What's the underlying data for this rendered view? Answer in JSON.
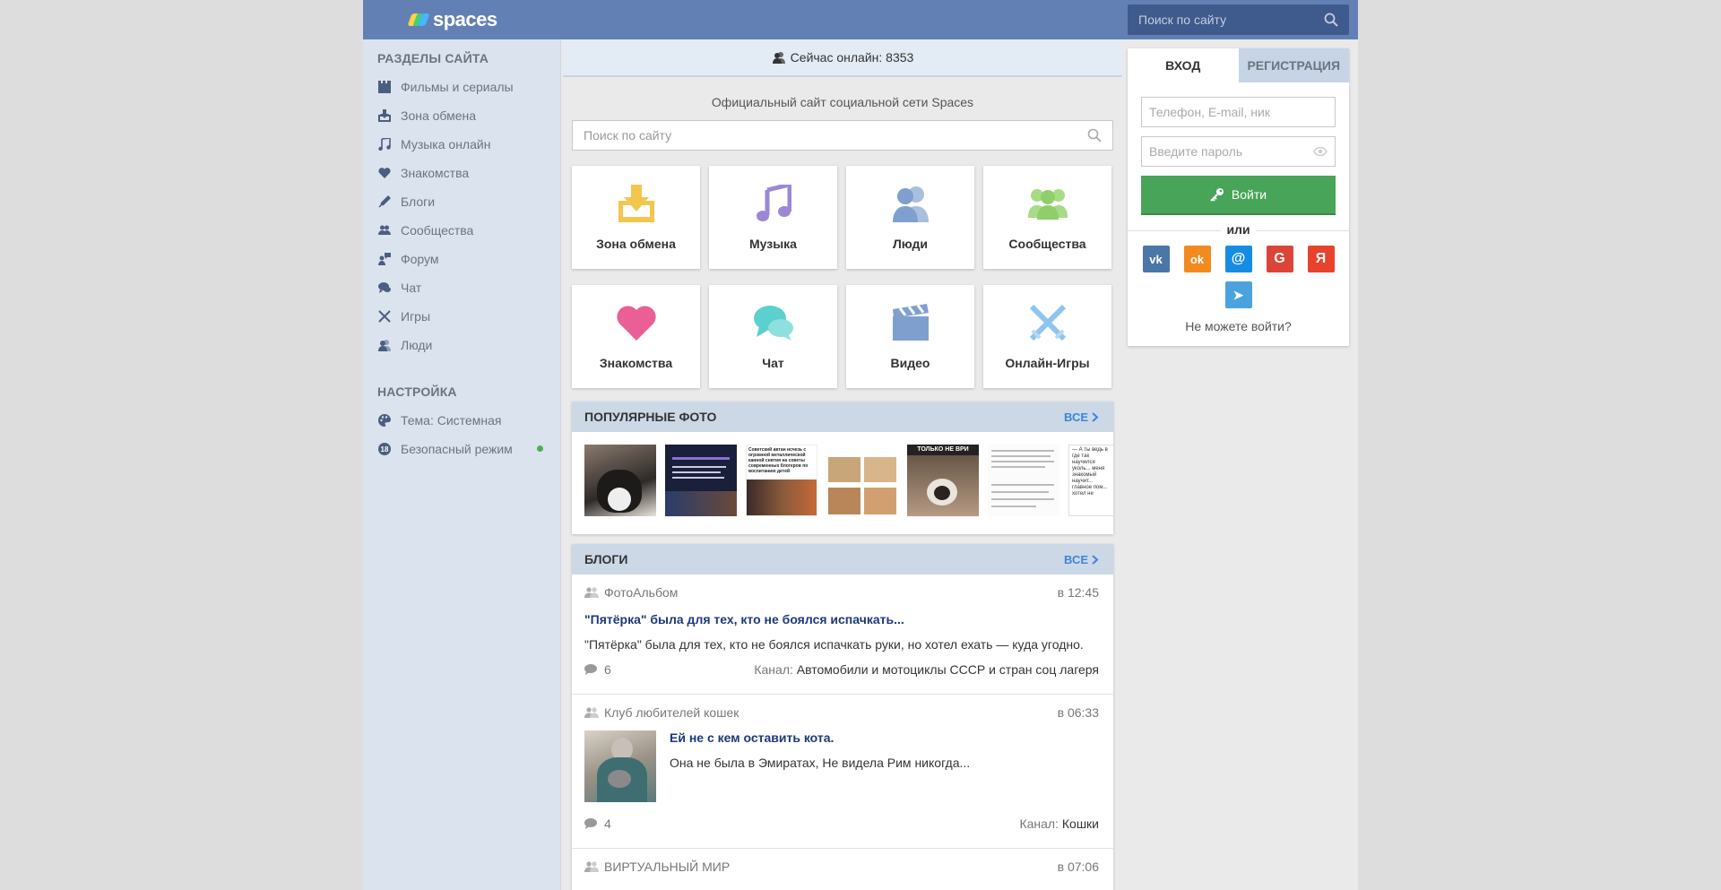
{
  "header": {
    "logo_text": "spaces",
    "search_placeholder": "Поиск по сайту"
  },
  "sidebar": {
    "sections_title": "РАЗДЕЛЫ САЙТА",
    "items": [
      {
        "label": "Фильмы и сериалы",
        "icon": "film-icon"
      },
      {
        "label": "Зона обмена",
        "icon": "download-icon"
      },
      {
        "label": "Музыка онлайн",
        "icon": "music-icon"
      },
      {
        "label": "Знакомства",
        "icon": "heart-icon"
      },
      {
        "label": "Блоги",
        "icon": "pen-icon"
      },
      {
        "label": "Сообщества",
        "icon": "group-icon"
      },
      {
        "label": "Форум",
        "icon": "forum-icon"
      },
      {
        "label": "Чат",
        "icon": "chat-icon"
      },
      {
        "label": "Игры",
        "icon": "swords-icon"
      },
      {
        "label": "Люди",
        "icon": "people-icon"
      }
    ],
    "settings_title": "НАСТРОЙКА",
    "settings": [
      {
        "label": "Тема: Системная",
        "icon": "palette-icon"
      },
      {
        "label": "Безопасный режим",
        "icon": "age-18-icon",
        "badge": "18",
        "status_color": "#4caf50"
      }
    ]
  },
  "main": {
    "online_label": "Сейчас онлайн: 8353",
    "official_text": "Официальный сайт социальной сети Spaces",
    "search_placeholder": "Поиск по сайту",
    "tiles_row1": [
      {
        "label": "Зона обмена",
        "icon": "download-icon",
        "color": "#f3c64e"
      },
      {
        "label": "Музыка",
        "icon": "music-icon",
        "color": "#9b87d6"
      },
      {
        "label": "Люди",
        "icon": "people-icon",
        "color": "#7f9fcf"
      },
      {
        "label": "Сообщества",
        "icon": "group-icon",
        "color": "#8fcf6a"
      }
    ],
    "tiles_row2": [
      {
        "label": "Знакомства",
        "icon": "heart-icon",
        "color": "#ea5f96"
      },
      {
        "label": "Чат",
        "icon": "chat-icon",
        "color": "#5ccfcf"
      },
      {
        "label": "Видео",
        "icon": "clapper-icon",
        "color": "#7f9fcf"
      },
      {
        "label": "Онлайн-Игры",
        "icon": "swords-icon",
        "color": "#8ec5ef"
      }
    ],
    "photos": {
      "title": "ПОПУЛЯРНЫЕ ФОТО",
      "all_label": "ВСЕ",
      "items": [
        {
          "caption": ""
        },
        {
          "caption": ""
        },
        {
          "caption": "Советский автан исчезь с огромной металлической канной снятия на советы современных блогеров по воспитанию детей"
        },
        {
          "caption": ""
        },
        {
          "caption": "ТОЛЬКО НЕ ВРИ"
        },
        {
          "caption": ""
        },
        {
          "caption": "— А ты ведь в где так научился уколь... меня знакомый научит... главное пом... хотел не"
        }
      ]
    },
    "blogs": {
      "title": "БЛОГИ",
      "all_label": "ВСЕ",
      "posts": [
        {
          "source": "ФотоАльбом",
          "time": "в 12:45",
          "title": "\"Пятёрка\" была для тех, кто не боялся испачкать...",
          "text": "\"Пятёрка\" была для тех, кто не боялся испачкать руки, но хотел ехать — куда угодно.",
          "comments": "6",
          "channel_label": "Канал:",
          "channel": "Автомобили и мотоциклы СССР и стран соц лагеря"
        },
        {
          "source": "Клуб любителей кошек",
          "time": "в 06:33",
          "title": "Ей не с кем оставить кота.",
          "text": "Она не была в Эмиратах, Не видела Рим никогда...",
          "comments": "4",
          "channel_label": "Канал:",
          "channel": "Кошки"
        },
        {
          "source": "ВИРТУАЛЬНЫЙ МИР",
          "time": "в 07:06"
        }
      ]
    }
  },
  "auth": {
    "tab_login": "ВХОД",
    "tab_register": "РЕГИСТРАЦИЯ",
    "login_placeholder": "Телефон, E-mail, ник",
    "password_placeholder": "Введите пароль",
    "login_button": "Войти",
    "or_label": "или",
    "socials": [
      {
        "name": "vk",
        "glyph": "vk",
        "color": "#4a76a8"
      },
      {
        "name": "odnoklassniki",
        "glyph": "ok",
        "color": "#f28a1e"
      },
      {
        "name": "mailru",
        "glyph": "@",
        "color": "#168de2"
      },
      {
        "name": "google",
        "glyph": "G",
        "color": "#db4437"
      },
      {
        "name": "yandex",
        "glyph": "Я",
        "color": "#e8412c"
      },
      {
        "name": "telegram",
        "glyph": "➤",
        "color": "#4aa3dc"
      }
    ],
    "cant_login": "Не можете войти?"
  },
  "colors": {
    "topbar": "#6380b5",
    "sidebar": "#dbe3ee",
    "accent_link": "#3b86d6",
    "login_green": "#48a458"
  }
}
